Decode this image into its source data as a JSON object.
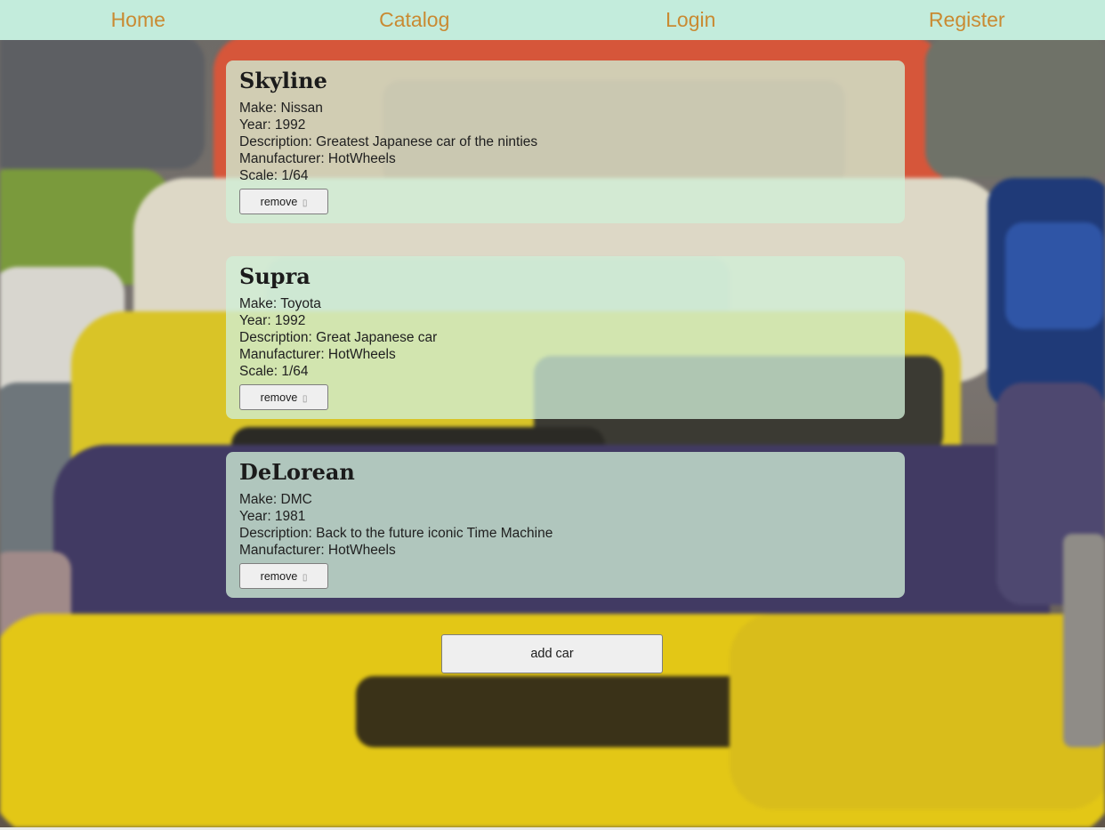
{
  "nav": {
    "items": [
      {
        "label": "Home"
      },
      {
        "label": "Catalog"
      },
      {
        "label": "Login"
      },
      {
        "label": "Register"
      }
    ]
  },
  "cars": [
    {
      "name": "Skyline",
      "make": "Make: Nissan",
      "year": "Year: 1992",
      "description": "Description: Greatest Japanese car of the ninties",
      "manufacturer": "Manufacturer: HotWheels",
      "scale": "Scale: 1/64",
      "remove_label": "remove"
    },
    {
      "name": "Supra",
      "make": "Make: Toyota",
      "year": "Year: 1992",
      "description": "Description: Great Japanese car",
      "manufacturer": "Manufacturer: HotWheels",
      "scale": "Scale: 1/64",
      "remove_label": "remove"
    },
    {
      "name": "DeLorean",
      "make": "Make: DMC",
      "year": "Year: 1981",
      "description": "Description: Back to the future iconic Time Machine",
      "manufacturer": "Manufacturer: HotWheels",
      "scale": "",
      "remove_label": "remove"
    }
  ],
  "add_button": {
    "label": "add car"
  },
  "icons": {
    "remove": "trash-icon"
  },
  "colors": {
    "nav_background": "#c3ecdc",
    "nav_link": "#c98a32",
    "card_background": "#d0eed6"
  }
}
